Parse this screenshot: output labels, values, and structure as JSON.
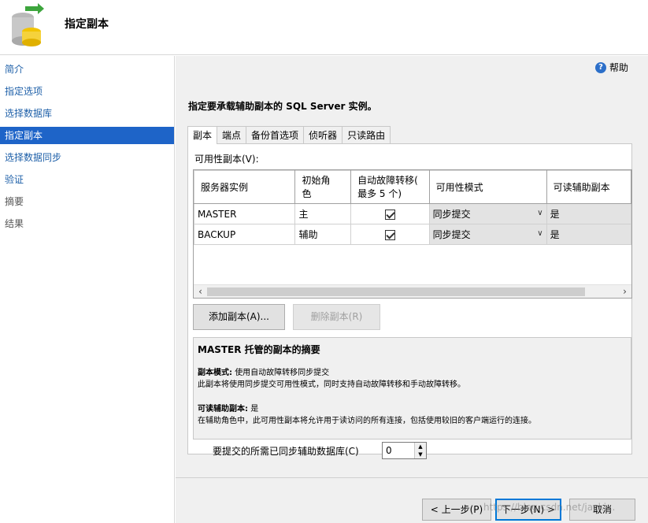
{
  "header": {
    "title": "指定副本"
  },
  "sidebar": {
    "items": [
      {
        "label": "简介"
      },
      {
        "label": "指定选项"
      },
      {
        "label": "选择数据库"
      },
      {
        "label": "指定副本"
      },
      {
        "label": "选择数据同步"
      },
      {
        "label": "验证"
      },
      {
        "label": "摘要"
      },
      {
        "label": "结果"
      }
    ]
  },
  "main": {
    "help_label": "帮助",
    "instruction": "指定要承载辅助副本的 SQL Server 实例。",
    "tabs": [
      {
        "label": "副本"
      },
      {
        "label": "端点"
      },
      {
        "label": "备份首选项"
      },
      {
        "label": "侦听器"
      },
      {
        "label": "只读路由"
      }
    ],
    "available_label": "可用性副本(V):",
    "grid": {
      "headers": [
        "服务器实例",
        "初始角\n色",
        "自动故障转移(\n最多 5 个)",
        "可用性模式",
        "可读辅助副本"
      ],
      "rows": [
        {
          "instance": "MASTER",
          "role": "主",
          "auto_failover": true,
          "mode": "同步提交",
          "readable": "是"
        },
        {
          "instance": "BACKUP",
          "role": "辅助",
          "auto_failover": true,
          "mode": "同步提交",
          "readable": "是"
        }
      ]
    },
    "add_replica_label": "添加副本(A)...",
    "remove_replica_label": "删除副本(R)",
    "summary": {
      "title": "MASTER 托管的副本的摘要",
      "mode_label": "副本模式:",
      "mode_value": "使用自动故障转移同步提交",
      "mode_desc": "此副本将使用同步提交可用性模式，同时支持自动故障转移和手动故障转移。",
      "readable_label": "可读辅助副本:",
      "readable_value": "是",
      "readable_desc": "在辅助角色中，此可用性副本将允许用于读访问的所有连接，包括使用较旧的客户端运行的连接。"
    },
    "sync_label": "要提交的所需已同步辅助数据库(C)",
    "sync_value": "0"
  },
  "footer": {
    "prev_label": "< 上一步(P)",
    "next_label": "下一步(N) >",
    "cancel_label": "取消",
    "watermark": "https://blog.csdn.net/jacki..."
  },
  "colors": {
    "accent": "#1e64c8",
    "link": "#1d5fa8"
  }
}
